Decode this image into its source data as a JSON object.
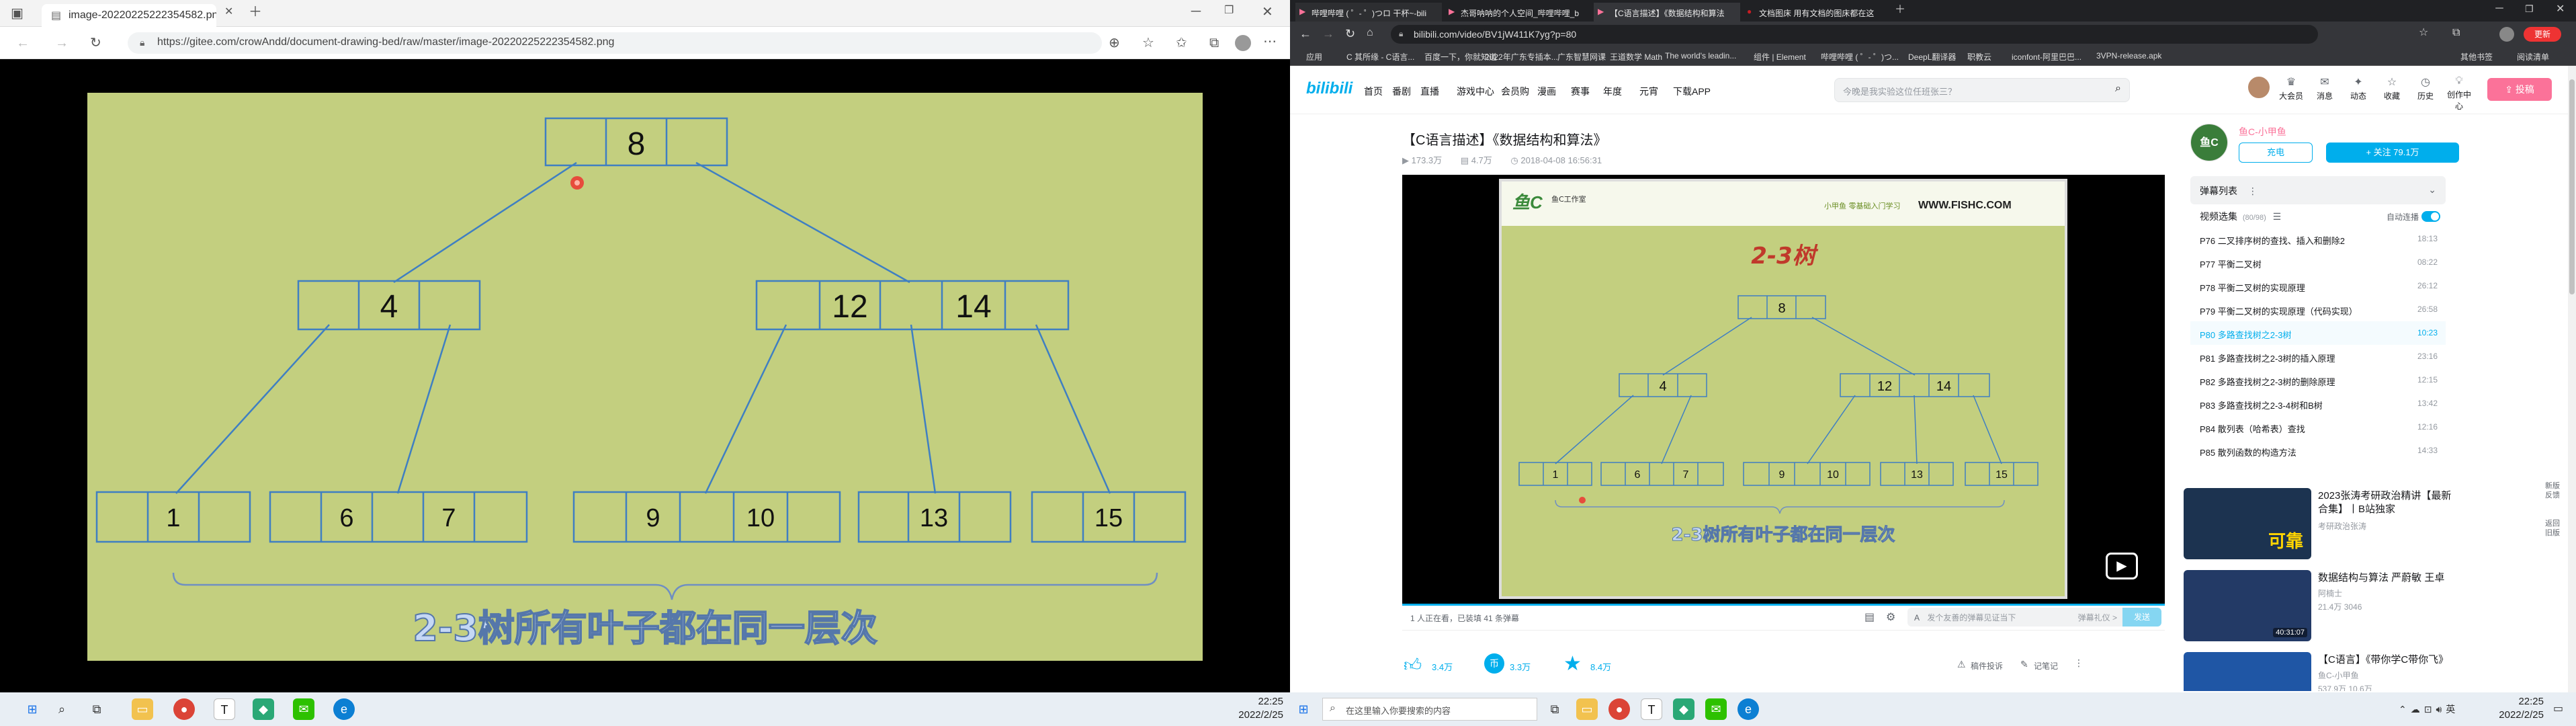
{
  "left": {
    "tab_title": "image-20220225222354582.png",
    "url": "https://gitee.com/crowAndd/document-drawing-bed/raw/master/image-20220225222354582.png",
    "tree": {
      "root": "8",
      "mid_left": "4",
      "mid_right_a": "12",
      "mid_right_b": "14",
      "leaves": [
        "1",
        "6",
        "7",
        "9",
        "10",
        "13",
        "15"
      ],
      "caption": "2-3树所有叶子都在同一层次"
    },
    "taskbar_time": "22:25",
    "taskbar_date": "2022/2/25"
  },
  "right": {
    "tabs": [
      "哔哩哔哩 ( ゜- ゜)つロ 干杯~-bili",
      "杰哥呐呐的个人空间_哔哩哔哩_b",
      "【C语言描述】《数据结构和算法",
      "文档图床 用有文档的图床都在这"
    ],
    "url": "bilibili.com/video/BV1jW411K7yg?p=80",
    "bookmarks": [
      "应用",
      "C 其所缘 - C语言...",
      "百度一下，你就知道",
      "2022年广东专插本...",
      "广东智慧网课",
      "王道数学 Math",
      "The world's leadin...",
      "组件 | Element",
      "哔哩哔哩 ( ゜- ゜)つ...",
      "DeepL翻译器",
      "职教云",
      "iconfont-阿里巴巴...",
      "3VPN-release.apk",
      "其他书签",
      "阅读清单"
    ],
    "nav": [
      "首页",
      "番剧",
      "直播",
      "游戏中心",
      "会员购",
      "漫画",
      "赛事",
      "年度",
      "元宵",
      "下载APP"
    ],
    "search_placeholder": "今晚是我实验这位任班张三？",
    "header_icons": [
      "大会员",
      "消息",
      "动态",
      "收藏",
      "历史",
      "创作中心"
    ],
    "upload_label": "投稿",
    "video_title": "【C语言描述】《数据结构和算法》",
    "video_meta": {
      "views": "173.3万",
      "danmaku": "4.7万",
      "date": "2018-04-08 16:56:31"
    },
    "slide": {
      "logo_text": "鱼C工作室",
      "site": "WWW.FISHC.COM",
      "slogan": "小甲鱼  零基础入门学习",
      "heading": "2-3树",
      "root": "8",
      "mid_left": "4",
      "mid_right_a": "12",
      "mid_right_b": "14",
      "leaves": [
        "1",
        "6",
        "7",
        "9",
        "10",
        "13",
        "15"
      ],
      "caption": "2-3树所有叶子都在同一层次"
    },
    "player_bar": {
      "viewers": "1 人正在看，已装填 41 条弹幕",
      "danmaku_placeholder": "发个友善的弹幕见证当下",
      "danmaku_etiquette": "弹幕礼仪 >",
      "send": "发送"
    },
    "actions": {
      "like": "3.4万",
      "coin": "3.3万",
      "fav": "8.4万",
      "share_label": "稿件投诉",
      "note_label": "记笔记"
    },
    "uploader": {
      "name": "鱼C-小甲鱼",
      "charge": "充电",
      "follow": "+ 关注 79.1万"
    },
    "danmaku_list_label": "弹幕列表",
    "series_label": "视频选集",
    "series_count": "(80/98)",
    "autoplay_label": "自动连播",
    "episodes": [
      {
        "label": "P76  二叉排序树的查找、插入和删除2",
        "time": "18:13"
      },
      {
        "label": "P77  平衡二叉树",
        "time": "08:22"
      },
      {
        "label": "P78  平衡二叉树的实现原理",
        "time": "26:12"
      },
      {
        "label": "P79  平衡二叉树的实现原理（代码实现）",
        "time": "26:58"
      },
      {
        "label": "P80  多路查找树之2-3树",
        "time": "10:23"
      },
      {
        "label": "P81  多路查找树之2-3树的插入原理",
        "time": "23:16"
      },
      {
        "label": "P82  多路查找树之2-3树的删除原理",
        "time": "12:15"
      },
      {
        "label": "P83  多路查找树之2-3-4树和B树",
        "time": "13:42"
      },
      {
        "label": "P84  散列表（哈希表）查找",
        "time": "12:16"
      },
      {
        "label": "P85  散列函数的构造方法",
        "time": "14:33"
      }
    ],
    "recs": [
      {
        "title": "2023张涛考研政治精讲【最新合集】丨B站独家",
        "author": "考研政治张涛",
        "thumb_text": "可靠"
      },
      {
        "title": "数据结构与算法 严蔚敏 王卓",
        "author": "阿楠士",
        "meta": "21.4万  3046",
        "duration": "40:31:07"
      },
      {
        "title": "【C语言】《带你学C带你飞》",
        "author": "鱼C-小甲鱼",
        "meta": "537.9万  10.6万",
        "thumb_text": "鱼C工作室出品"
      }
    ],
    "side_tabs": [
      "新版反馈",
      "返回旧版"
    ],
    "taskbar_search": "在这里输入你要搜索的内容",
    "taskbar_time": "22:25",
    "taskbar_date": "2022/2/25",
    "colors": {
      "bili_blue": "#00aeec",
      "bili_pink": "#fb7299",
      "slide_bg": "#c3cf7f",
      "box": "#3f7fc2"
    }
  }
}
